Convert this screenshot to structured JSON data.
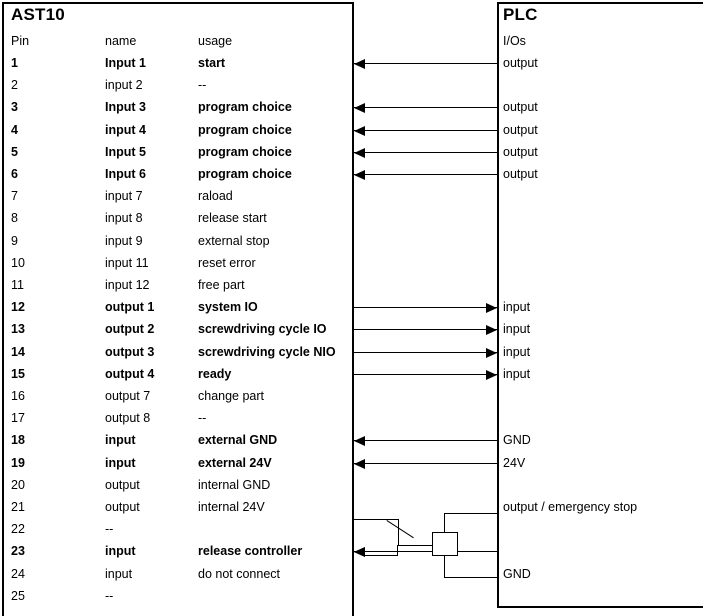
{
  "left_panel": {
    "title": "AST10",
    "columns": {
      "pin": "Pin",
      "name": "name",
      "usage": "usage"
    },
    "rows": [
      {
        "pin": "1",
        "name": "Input 1",
        "usage": "start",
        "bold": true
      },
      {
        "pin": "2",
        "name": "input 2",
        "usage": "--",
        "bold": false
      },
      {
        "pin": "3",
        "name": "Input 3",
        "usage": "program choice",
        "bold": true
      },
      {
        "pin": "4",
        "name": "input 4",
        "usage": "program choice",
        "bold": true
      },
      {
        "pin": "5",
        "name": "Input 5",
        "usage": "program choice",
        "bold": true
      },
      {
        "pin": "6",
        "name": "Input 6",
        "usage": "program choice",
        "bold": true
      },
      {
        "pin": "7",
        "name": "input 7",
        "usage": "raload",
        "bold": false
      },
      {
        "pin": "8",
        "name": "input 8",
        "usage": "release start",
        "bold": false
      },
      {
        "pin": "9",
        "name": "input 9",
        "usage": "external stop",
        "bold": false
      },
      {
        "pin": "10",
        "name": "input 11",
        "usage": "reset error",
        "bold": false
      },
      {
        "pin": "11",
        "name": "input 12",
        "usage": "free part",
        "bold": false
      },
      {
        "pin": "12",
        "name": "output 1",
        "usage": "system IO",
        "bold": true
      },
      {
        "pin": "13",
        "name": "output 2",
        "usage": "screwdriving cycle IO",
        "bold": true
      },
      {
        "pin": "14",
        "name": "output 3",
        "usage": "screwdriving cycle NIO",
        "bold": true
      },
      {
        "pin": "15",
        "name": "output 4",
        "usage": "ready",
        "bold": true
      },
      {
        "pin": "16",
        "name": "output 7",
        "usage": "change part",
        "bold": false
      },
      {
        "pin": "17",
        "name": "output 8",
        "usage": "--",
        "bold": false
      },
      {
        "pin": "18",
        "name": "input",
        "usage": "external GND",
        "bold": true
      },
      {
        "pin": "19",
        "name": "input",
        "usage": "external 24V",
        "bold": true
      },
      {
        "pin": "20",
        "name": "output",
        "usage": "internal GND",
        "bold": false
      },
      {
        "pin": "21",
        "name": "output",
        "usage": "internal 24V",
        "bold": false
      },
      {
        "pin": "22",
        "name": "--",
        "usage": "",
        "bold": false
      },
      {
        "pin": "23",
        "name": "input",
        "usage": "release controller",
        "bold": true
      },
      {
        "pin": "24",
        "name": "input",
        "usage": "do not connect",
        "bold": false
      },
      {
        "pin": "25",
        "name": "--",
        "usage": "",
        "bold": false
      }
    ]
  },
  "right_panel": {
    "title": "PLC",
    "header": "I/Os",
    "labels": [
      {
        "text": "output",
        "row": 1
      },
      {
        "text": "output",
        "row": 3
      },
      {
        "text": "output",
        "row": 4
      },
      {
        "text": "output",
        "row": 5
      },
      {
        "text": "output",
        "row": 6
      },
      {
        "text": "input",
        "row": 12
      },
      {
        "text": "input",
        "row": 13
      },
      {
        "text": "input",
        "row": 14
      },
      {
        "text": "input",
        "row": 15
      },
      {
        "text": "GND",
        "row": 18
      },
      {
        "text": "24V",
        "row": 19
      },
      {
        "text": "output / emergency stop",
        "row": 21
      },
      {
        "text": "GND",
        "row": 24
      }
    ]
  },
  "connections": [
    {
      "pin": "1",
      "direction": "to-ast10",
      "row": 1
    },
    {
      "pin": "3",
      "direction": "to-ast10",
      "row": 3
    },
    {
      "pin": "4",
      "direction": "to-ast10",
      "row": 4
    },
    {
      "pin": "5",
      "direction": "to-ast10",
      "row": 5
    },
    {
      "pin": "6",
      "direction": "to-ast10",
      "row": 6
    },
    {
      "pin": "12",
      "direction": "to-plc",
      "row": 12
    },
    {
      "pin": "13",
      "direction": "to-plc",
      "row": 13
    },
    {
      "pin": "14",
      "direction": "to-plc",
      "row": 14
    },
    {
      "pin": "15",
      "direction": "to-plc",
      "row": 15
    },
    {
      "pin": "18",
      "direction": "to-ast10",
      "row": 18
    },
    {
      "pin": "19",
      "direction": "to-ast10",
      "row": 19
    },
    {
      "pin": "23",
      "direction": "to-ast10",
      "row": 23
    }
  ],
  "relay_circuit": {
    "contact_label": "",
    "coil_label": "",
    "top_net": "output / emergency stop",
    "bottom_net": "GND"
  },
  "style": {
    "line_color": "#000000",
    "background": "#ffffff"
  }
}
